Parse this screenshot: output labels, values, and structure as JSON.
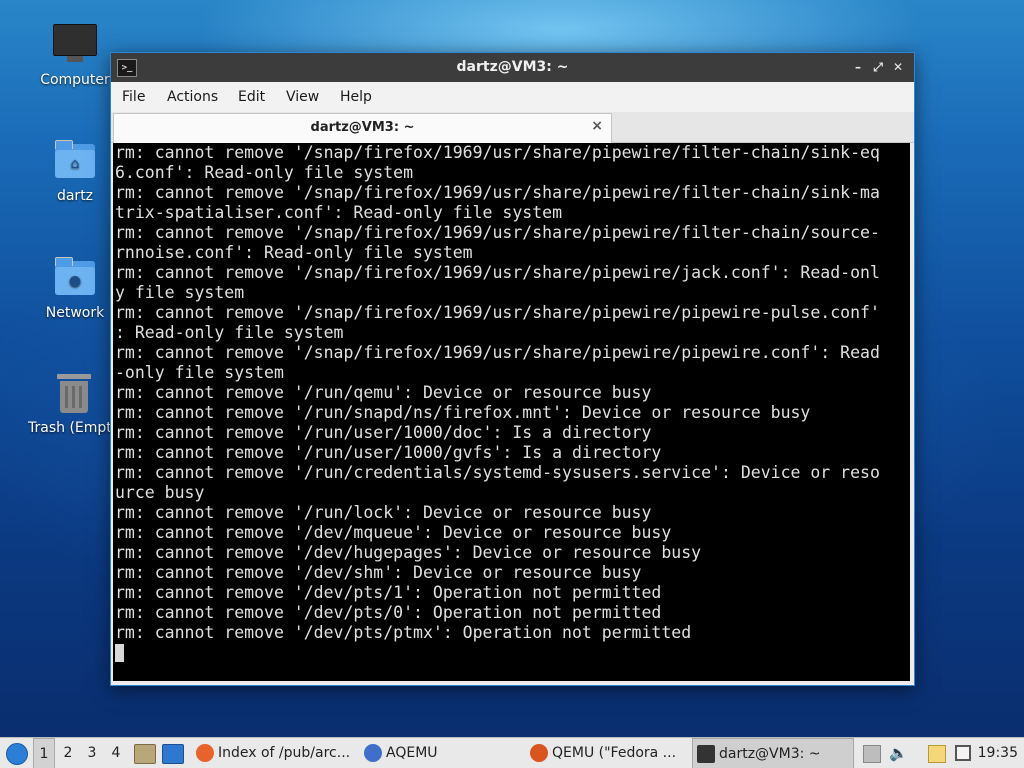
{
  "desktop": {
    "icons": [
      {
        "label": "Computer",
        "icon": "computer-icon"
      },
      {
        "label": "dartz",
        "icon": "home-folder-icon"
      },
      {
        "label": "Network",
        "icon": "network-folder-icon"
      },
      {
        "label": "Trash (Empt",
        "icon": "trash-icon"
      }
    ]
  },
  "window": {
    "title": "dartz@VM3: ~",
    "menu": [
      "File",
      "Actions",
      "Edit",
      "View",
      "Help"
    ],
    "tab_title": "dartz@VM3: ~",
    "tab_close": "×",
    "app_icon_glyph": ">_",
    "controls": {
      "minimize": "–",
      "maximize": "⤢",
      "close": "✕"
    }
  },
  "terminal": {
    "lines": [
      "rm: cannot remove '/snap/firefox/1969/usr/share/pipewire/filter-chain/sink-eq",
      "6.conf': Read-only file system",
      "rm: cannot remove '/snap/firefox/1969/usr/share/pipewire/filter-chain/sink-ma",
      "trix-spatialiser.conf': Read-only file system",
      "rm: cannot remove '/snap/firefox/1969/usr/share/pipewire/filter-chain/source-",
      "rnnoise.conf': Read-only file system",
      "rm: cannot remove '/snap/firefox/1969/usr/share/pipewire/jack.conf': Read-onl",
      "y file system",
      "rm: cannot remove '/snap/firefox/1969/usr/share/pipewire/pipewire-pulse.conf'",
      ": Read-only file system",
      "rm: cannot remove '/snap/firefox/1969/usr/share/pipewire/pipewire.conf': Read",
      "-only file system",
      "rm: cannot remove '/run/qemu': Device or resource busy",
      "rm: cannot remove '/run/snapd/ns/firefox.mnt': Device or resource busy",
      "rm: cannot remove '/run/user/1000/doc': Is a directory",
      "rm: cannot remove '/run/user/1000/gvfs': Is a directory",
      "rm: cannot remove '/run/credentials/systemd-sysusers.service': Device or reso",
      "urce busy",
      "rm: cannot remove '/run/lock': Device or resource busy",
      "rm: cannot remove '/dev/mqueue': Device or resource busy",
      "rm: cannot remove '/dev/hugepages': Device or resource busy",
      "rm: cannot remove '/dev/shm': Device or resource busy",
      "rm: cannot remove '/dev/pts/1': Operation not permitted",
      "rm: cannot remove '/dev/pts/0': Operation not permitted",
      "rm: cannot remove '/dev/pts/ptmx': Operation not permitted"
    ]
  },
  "taskbar": {
    "workspaces": [
      "1",
      "2",
      "3",
      "4"
    ],
    "active_workspace": "1",
    "tasks": [
      {
        "label": "Index of /pub/arc...",
        "icon": "firefox-icon",
        "color": "#e8622c"
      },
      {
        "label": "AQEMU",
        "icon": "aqemu-icon",
        "color": "#3f6fc8"
      },
      {
        "label": "QEMU (\"Fedora ...",
        "icon": "qemu-icon",
        "color": "#d8551f"
      },
      {
        "label": "dartz@VM3: ~",
        "icon": "terminal-icon",
        "color": "#333333"
      }
    ],
    "clock": "19:35"
  }
}
